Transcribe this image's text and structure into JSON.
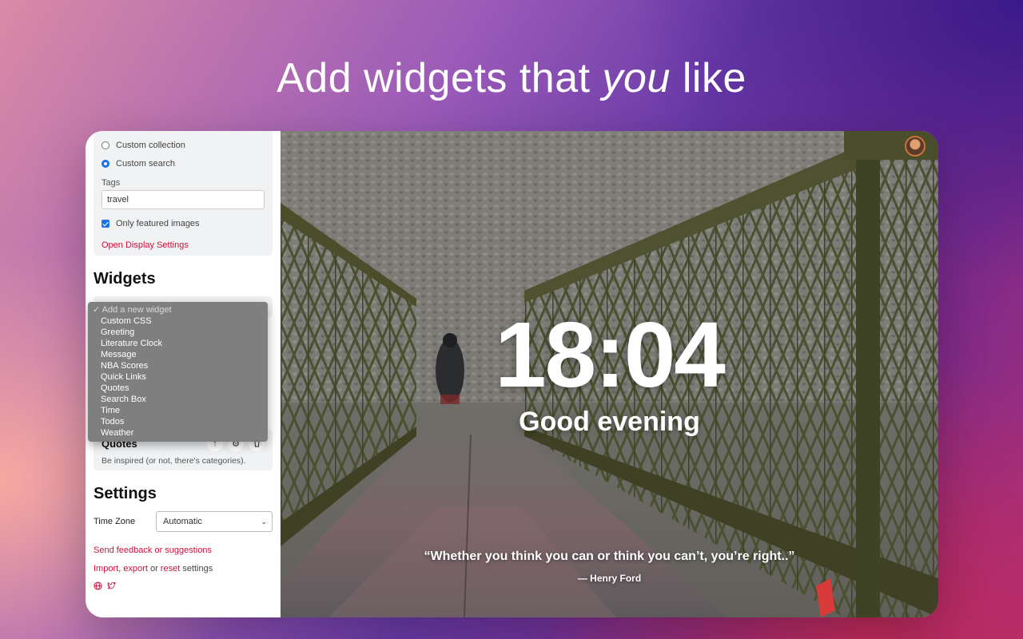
{
  "headline": {
    "before": "Add widgets that ",
    "emphasis": "you",
    "after": " like"
  },
  "sidebar": {
    "background_options": [
      {
        "label": "Custom collection",
        "checked": false
      },
      {
        "label": "Custom search",
        "checked": true
      }
    ],
    "tags_label": "Tags",
    "tags_value": "travel",
    "featured_label": "Only featured images",
    "featured_checked": true,
    "display_settings_link": "Open Display Settings",
    "widgets_heading": "Widgets",
    "widget_dropdown": {
      "placeholder": "Add a new widget",
      "options": [
        "Custom CSS",
        "Greeting",
        "Literature Clock",
        "Message",
        "NBA Scores",
        "Quick Links",
        "Quotes",
        "Search Box",
        "Time",
        "Todos",
        "Weather"
      ]
    },
    "quotes_widget": {
      "title": "Quotes",
      "description": "Be inspired (or not, there's categories).",
      "icons": [
        "arrow-up-icon",
        "gear-icon",
        "trash-icon"
      ]
    },
    "settings_heading": "Settings",
    "timezone_label": "Time Zone",
    "timezone_value": "Automatic",
    "feedback_link": "Send feedback or suggestions",
    "import_link": "Import",
    "export_link": "export",
    "or_text": "or",
    "reset_link": "reset",
    "settings_text": "settings",
    "footer_icons": [
      "globe-icon",
      "twitter-icon"
    ]
  },
  "main": {
    "time": "18:04",
    "greeting": "Good evening",
    "quote": "“Whether you think you can or think you can’t, you’re right..”",
    "author": "— Henry Ford"
  },
  "colors": {
    "accent_red": "#d0103a",
    "checkbox_blue": "#1a73e8"
  }
}
